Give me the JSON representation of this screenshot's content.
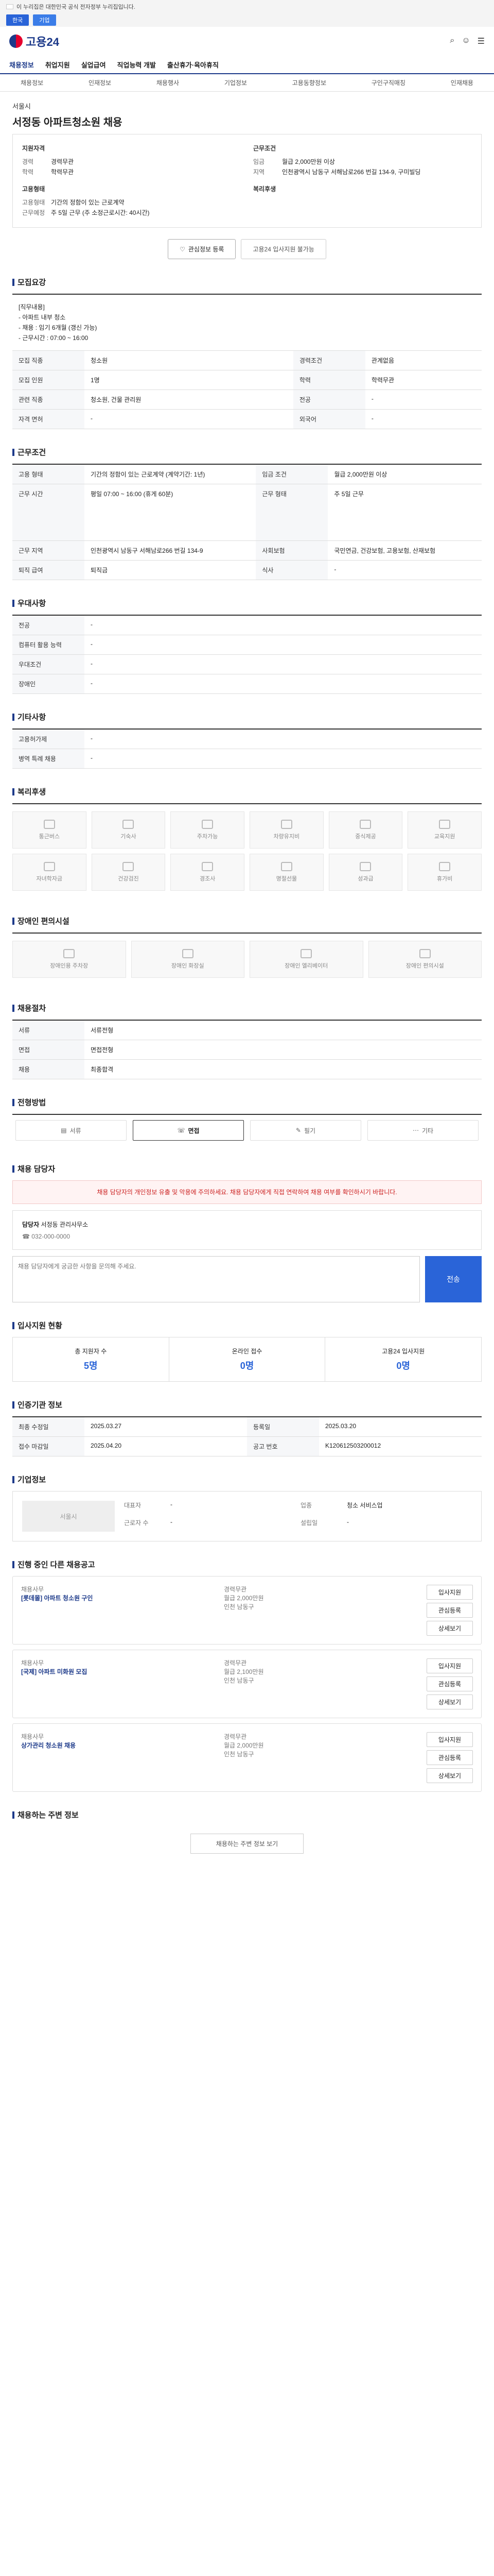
{
  "gov_banner": "이 누리집은 대한민국 공식 전자정부 누리집입니다.",
  "lang": {
    "a": "한국",
    "b": "기업"
  },
  "brand": "고용24",
  "gnb": [
    "채용정보",
    "취업지원",
    "실업급여",
    "직업능력 개발",
    "출산휴가·육아휴직"
  ],
  "subnav": [
    "채용정보",
    "인재정보",
    "채용행사",
    "기업정보",
    "고용동향정보",
    "구인구직매칭",
    "인재채용"
  ],
  "company_name": "서울시",
  "job_title": "서정동 아파트청소원 채용",
  "top": {
    "left_title": "지원자격",
    "left": [
      [
        "경력",
        "경력무관"
      ],
      [
        "학력",
        "학력무관"
      ]
    ],
    "right_title": "근무조건",
    "right": [
      [
        "임금",
        "월급 2,000만원 이상"
      ],
      [
        "지역",
        "인천광역시 남동구 서해남로266 번길 134-9, 구미빌딩"
      ]
    ],
    "mgr_title": "고용형태",
    "mgr": [
      [
        "고용형태",
        "기간의 정함이 있는 근로계약"
      ],
      [
        "근무예정",
        "주 5일 근무 (주 소정근로시간: 40시간)"
      ]
    ],
    "welfare_title": "복리후생"
  },
  "buttons": {
    "save": "관심정보 등록",
    "apply": "고용24 입사지원 불가능"
  },
  "sections": {
    "recruit": "모집요강",
    "work": "근무조건",
    "support": "우대사항",
    "etc": "기타사항",
    "welfare": "복리후생",
    "disabled": "장애인 편의시설",
    "process": "채용절차",
    "apply_method": "전형방법",
    "contact": "채용 담당자",
    "applicant": "입사지원 현황",
    "info": "인증기관 정보",
    "company": "기업정보",
    "similar": "진행 중인 다른 채용공고",
    "nearby": "채용하는 주변 정보"
  },
  "recruit_desc": "[직무내용]\n- 아파트 내부 청소\n- 채용 : 임기 6개월 (갱신 가능)\n- 근무시간 : 07:00 ~ 16:00",
  "recruit_rows": [
    [
      "모집 직종",
      "청소원",
      "경력조건",
      "관계없음"
    ],
    [
      "모집 인원",
      "1명",
      "학력",
      "학력무관"
    ],
    [
      "관련 직종",
      "청소원, 건물 관리원",
      "전공",
      "-"
    ],
    [
      "자격 면허",
      "-",
      "외국어",
      "-"
    ]
  ],
  "work_rows": [
    [
      "고용 형태",
      "기간의 정함이 있는 근로계약 (계약기간: 1년)",
      "임금 조건",
      "월급 2,000만원 이상"
    ],
    [
      "근무 시간",
      "평일 07:00 ~ 16:00 (휴게 60분)",
      "근무 형태",
      "주 5일 근무"
    ],
    [
      "근무 지역",
      "인천광역시 남동구 서해남로266 번길 134-9",
      "사회보험",
      "국민연금, 건강보험, 고용보험, 산재보험"
    ],
    [
      "퇴직 급여",
      "퇴직금",
      "식사",
      "-"
    ]
  ],
  "welfare_items": [
    "통근버스",
    "기숙사",
    "주차가능",
    "차량유지비",
    "중식제공",
    "교육지원",
    "자녀학자금",
    "건강검진",
    "경조사",
    "명절선물",
    "성과급",
    "휴가비"
  ],
  "disabled_items": [
    "장애인용 주차장",
    "장애인 화장실",
    "장애인 엘리베이터",
    "장애인 편의시설"
  ],
  "process_rows": [
    [
      "서류",
      "서류전형"
    ],
    [
      "면접",
      "면접전형"
    ],
    [
      "채용",
      "최종합격"
    ]
  ],
  "tabs": [
    "서류",
    "면접",
    "필기",
    "기타"
  ],
  "contact": {
    "notice": "채용 담당자의 개인정보 유출 및 악용에 주의하세요. 채용 담당자에게 직접 연락하여 채용 여부를 확인하시기 바랍니다.",
    "name_label": "담당자",
    "name": "서정동 관리사무소",
    "phone": "032-000-0000",
    "inquiry_placeholder": "채용 담당자에게 궁금한 사항을 문의해 주세요.",
    "send": "전송"
  },
  "applicant": [
    [
      "총 지원자 수",
      "5명"
    ],
    [
      "온라인 접수",
      "0명"
    ],
    [
      "고용24 입사지원",
      "0명"
    ]
  ],
  "info_rows": [
    [
      "최종 수정일",
      "2025.03.27",
      "등록일",
      "2025.03.20"
    ],
    [
      "접수 마감일",
      "2025.04.20",
      "공고 번호",
      "K120612503200012"
    ]
  ],
  "company": {
    "name": "서울시",
    "rows": [
      [
        "대표자",
        "-"
      ],
      [
        "업종",
        "청소 서비스업"
      ],
      [
        "근로자 수",
        "-"
      ],
      [
        "설립일",
        "-"
      ]
    ]
  },
  "similar": [
    {
      "company": "채용사무",
      "title": "[롯데몰] 아파트 청소원 구인",
      "a": "경력무관",
      "b": "월급 2,000만원",
      "c": "인천 남동구"
    },
    {
      "company": "채용사무",
      "title": "[국제] 아파트 미화원 모집",
      "a": "경력무관",
      "b": "월급 2,100만원",
      "c": "인천 남동구"
    },
    {
      "company": "채용사무",
      "title": "상가관리 청소원 채용",
      "a": "경력무관",
      "b": "월급 2,000만원",
      "c": "인천 남동구"
    }
  ],
  "similar_btns": [
    "입사지원",
    "관심등록",
    "상세보기"
  ],
  "footer_btn": "채용하는 주변 정보 보기"
}
